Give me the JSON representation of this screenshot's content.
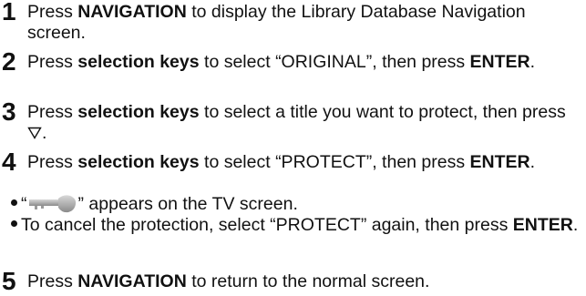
{
  "steps": [
    {
      "number": "1",
      "parts": [
        "Press ",
        "NAVIGATION",
        " to display the Library Database Navigation screen."
      ]
    },
    {
      "number": "2",
      "parts": [
        "Press ",
        "selection keys",
        " to select “ORIGINAL”, then press ",
        "ENTER",
        "."
      ]
    },
    {
      "number": "3",
      "parts": [
        "Press ",
        "selection keys",
        " to select a title you want to protect, then press ",
        "."
      ]
    },
    {
      "number": "4",
      "parts": [
        "Press ",
        "selection keys",
        " to select “PROTECT”, then press ",
        "ENTER",
        "."
      ]
    },
    {
      "number": "5",
      "parts": [
        "Press ",
        "NAVIGATION",
        " to return to the normal screen."
      ]
    }
  ],
  "bullets": [
    {
      "before": "“",
      "icon": "key-icon",
      "after": "” appears on the TV screen."
    },
    {
      "parts": [
        "To cancel the protection, select “PROTECT” again, then press ",
        "ENTER",
        "."
      ]
    }
  ],
  "icons": {
    "down_triangle": "down-triangle-icon",
    "key": "key-icon"
  }
}
